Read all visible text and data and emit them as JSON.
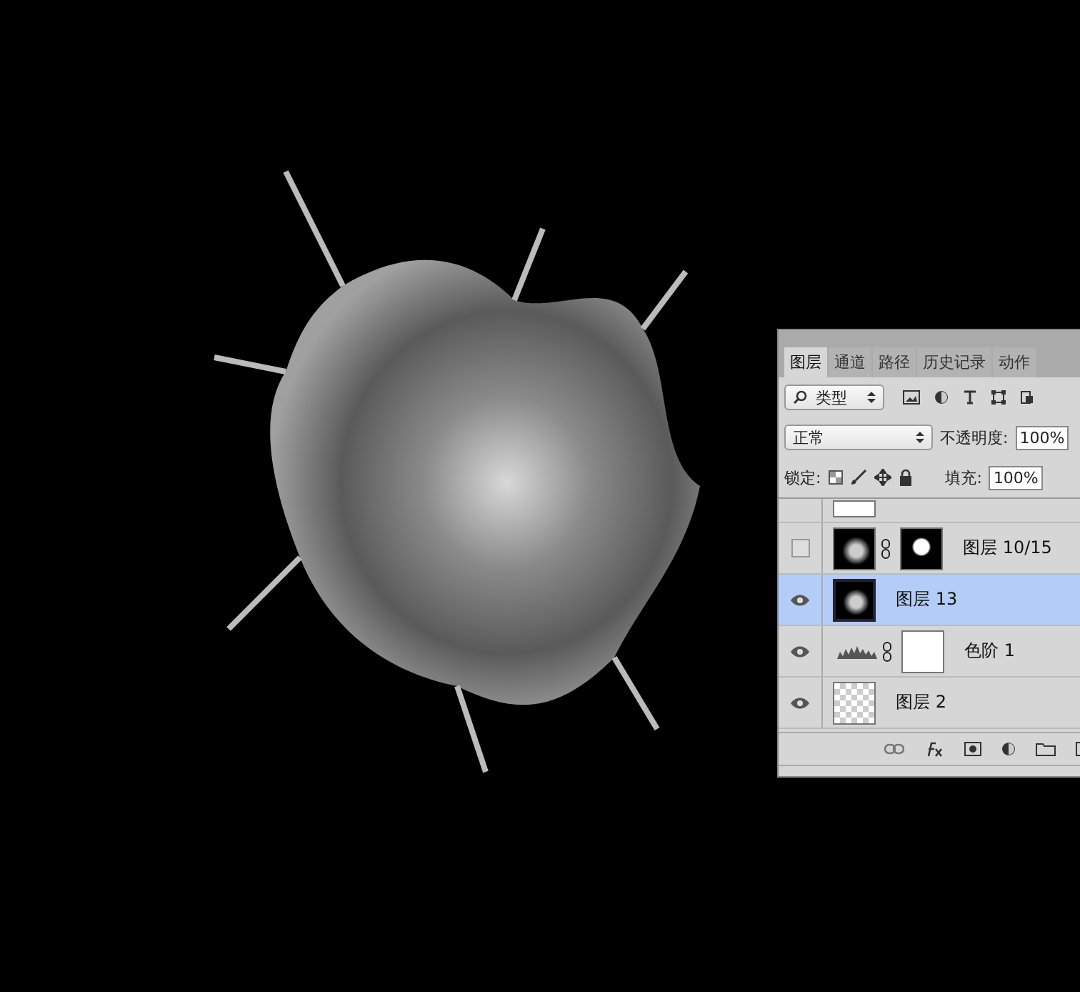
{
  "layers_panel": {
    "tabs": [
      {
        "label": "图层",
        "selected": true
      },
      {
        "label": "通道",
        "selected": false
      },
      {
        "label": "路径",
        "selected": false
      },
      {
        "label": "历史记录",
        "selected": false
      },
      {
        "label": "动作",
        "selected": false
      }
    ],
    "filter": {
      "value": "类型"
    },
    "blend_mode": {
      "value": "正常"
    },
    "opacity": {
      "label": "不透明度:",
      "value": "100%"
    },
    "lock": {
      "label": "锁定:"
    },
    "fill": {
      "label": "填充:",
      "value": "100%"
    },
    "layers": [
      {
        "kind": "masked",
        "name": "图层 10/15",
        "visible": false,
        "selected": false
      },
      {
        "kind": "pixel",
        "name": "图层 13",
        "visible": true,
        "selected": true
      },
      {
        "kind": "adjustment",
        "name": "色阶 1",
        "visible": true,
        "selected": false
      },
      {
        "kind": "transparent",
        "name": "图层 2",
        "visible": true,
        "selected": false
      }
    ]
  }
}
